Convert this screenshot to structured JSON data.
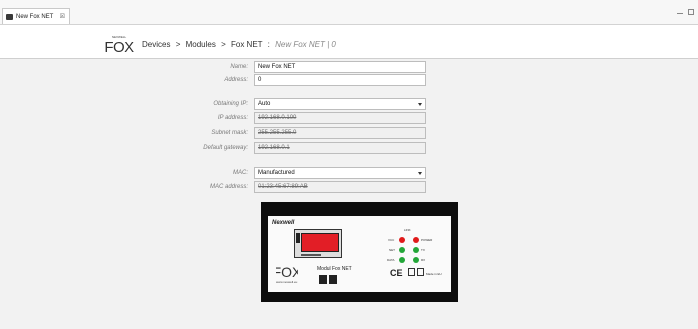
{
  "tab": {
    "title": "New Fox NET",
    "close_glyph": "☒"
  },
  "header": {
    "logo_text": "FOX",
    "logo_small": "NEXWELL",
    "breadcrumb": {
      "devices": "Devices",
      "modules": "Modules",
      "fox_net": "Fox NET",
      "separator": ">",
      "current_sep": ":",
      "current": "New Fox NET | 0"
    }
  },
  "form": {
    "name_label": "Name:",
    "name_value": "New Fox NET",
    "address_label": "Address:",
    "address_value": "0",
    "obtaining_ip_label": "Obtaining IP:",
    "obtaining_ip_value": "Auto",
    "ip_address_label": "IP address:",
    "ip_address_value": "192.168.0.100",
    "subnet_mask_label": "Subnet mask:",
    "subnet_mask_value": "255.255.255.0",
    "gateway_label": "Default gateway:",
    "gateway_value": "192.168.0.1",
    "mac_label": "MAC:",
    "mac_value": "Manufactured",
    "mac_address_label": "MAC address:",
    "mac_address_value": "01:23:45:67:89:AB"
  },
  "device_image": {
    "brand": "Nexwell",
    "module_name": "Modul Fox NET",
    "url": "www.nexwell.eu",
    "ce": "CE",
    "made_in": "Made in EU",
    "led_header": "LINK",
    "leds": [
      {
        "label": "VCC",
        "color": "#e01a1a"
      },
      {
        "label": "NET",
        "color": "#23a638"
      },
      {
        "label": "DATA",
        "color": "#23a638"
      }
    ],
    "leds_right": [
      {
        "label": "POWER",
        "color": "#e01a1a"
      },
      {
        "label": "TX",
        "color": "#23a638"
      },
      {
        "label": "RX",
        "color": "#23a638"
      }
    ],
    "display_color": "#e21e26"
  }
}
